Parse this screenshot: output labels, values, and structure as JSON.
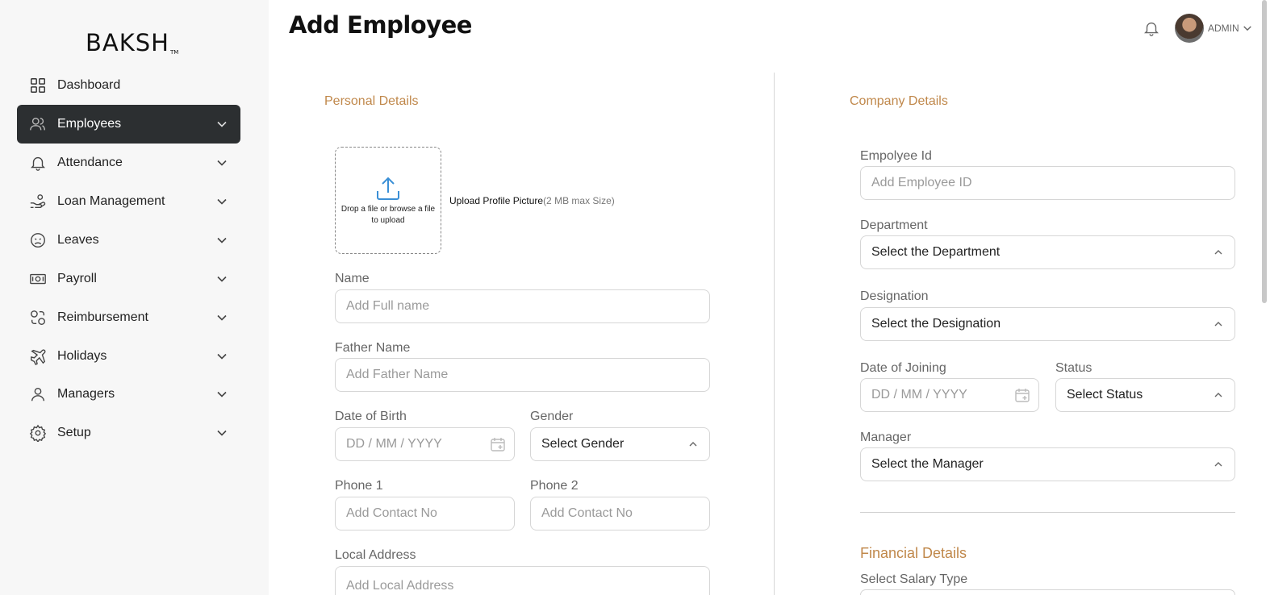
{
  "brand": {
    "name": "BAKSH",
    "tm": "TM"
  },
  "sidebar": {
    "items": [
      {
        "label": "Dashboard",
        "icon": "grid-icon"
      },
      {
        "label": "Employees",
        "icon": "users-icon"
      },
      {
        "label": "Attendance",
        "icon": "bell-icon"
      },
      {
        "label": "Loan Management",
        "icon": "hand-coins-icon"
      },
      {
        "label": "Leaves",
        "icon": "sad-face-icon"
      },
      {
        "label": "Payroll",
        "icon": "banknote-icon"
      },
      {
        "label": "Reimbursement",
        "icon": "refund-icon"
      },
      {
        "label": "Holidays",
        "icon": "plane-icon"
      },
      {
        "label": "Managers",
        "icon": "user-icon"
      },
      {
        "label": "Setup",
        "icon": "gear-icon"
      }
    ],
    "active_index": 1
  },
  "header": {
    "title": "Add Employee",
    "user": "ADMIN"
  },
  "personal": {
    "title": "Personal Details",
    "upload": {
      "box_text": "Drop a file or browse a file to upload",
      "label": "Upload Profile Picture",
      "hint": "(2 MB max Size)"
    },
    "name": {
      "label": "Name",
      "placeholder": "Add Full name"
    },
    "father": {
      "label": "Father Name",
      "placeholder": "Add Father Name"
    },
    "dob": {
      "label": "Date of Birth",
      "placeholder": "DD / MM / YYYY"
    },
    "gender": {
      "label": "Gender",
      "value": "Select Gender"
    },
    "phone1": {
      "label": "Phone 1",
      "placeholder": "Add Contact No"
    },
    "phone2": {
      "label": "Phone 2",
      "placeholder": "Add Contact No"
    },
    "address": {
      "label": "Local Address",
      "placeholder": "Add Local Address"
    }
  },
  "company": {
    "title": "Company Details",
    "emp_id": {
      "label": "Empolyee Id",
      "placeholder": "Add Employee ID"
    },
    "department": {
      "label": "Department",
      "value": "Select the Department"
    },
    "designation": {
      "label": "Designation",
      "value": "Select the Designation"
    },
    "doj": {
      "label": "Date of Joining",
      "placeholder": "DD / MM / YYYY"
    },
    "status": {
      "label": "Status",
      "value": "Select Status"
    },
    "manager": {
      "label": "Manager",
      "value": "Select the Manager"
    }
  },
  "financial": {
    "title": "Financial Details",
    "salary_type_label": "Select Salary Type"
  },
  "colors": {
    "accent": "#c0884b",
    "active_nav": "#2c2f31",
    "sidebar_bg": "#f7f7f7"
  }
}
